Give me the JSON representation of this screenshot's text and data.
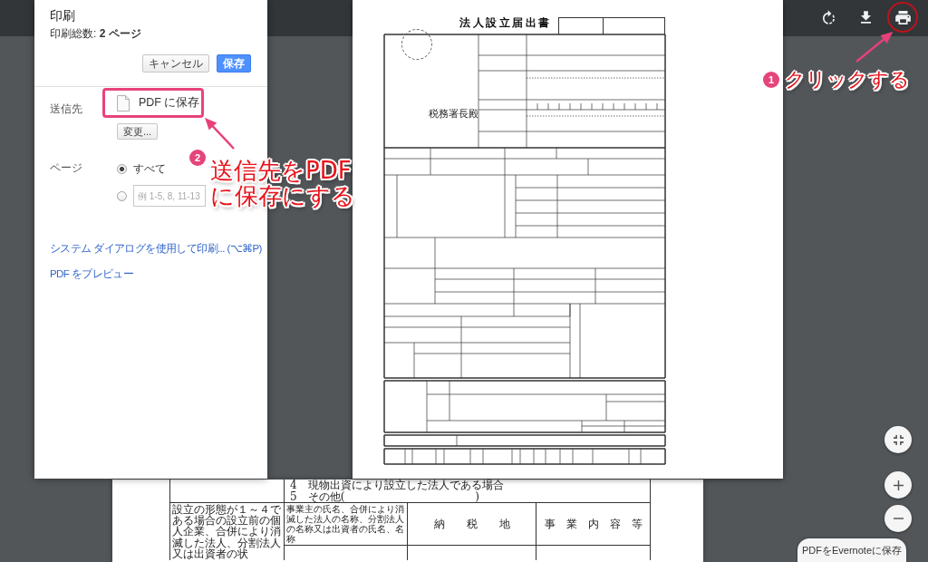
{
  "print_dialog": {
    "title": "印刷",
    "total": "印刷総数: **2 ページ**",
    "buttons": [
      {
        "label": "キャンセル",
        "kind": "secondary"
      },
      {
        "label": "保存",
        "kind": "primary"
      }
    ],
    "destination": {
      "label": "送信先",
      "value": "PDF に保存",
      "change_button": "変更..."
    },
    "pages": {
      "label": "ページ",
      "options": [
        {
          "kind": "all",
          "label": "すべて",
          "selected": true
        },
        {
          "kind": "range",
          "placeholder": "例 1-5, 8, 11-13",
          "selected": false
        }
      ]
    },
    "links": [
      "システム ダイアログを使用して印刷... (⌥⌘P)",
      "PDF をプレビュー"
    ]
  },
  "preview": {
    "form_title": "法人設立届出書",
    "addressee": "税務署長殿",
    "next_page": {
      "options": [
        "4　現物出資により設立した法人である場合",
        "5　その他(　　　　　　　　　　　　)"
      ],
      "row_label": "設立の形態が１～４である場合の設立前の個人企業、合併により消滅した法人、分割法人又は出資者の状",
      "columns": [
        "事業主の氏名、合併により消滅した法人の名称、分割法人の名称又は出資者の氏名、名称",
        "納　　税　　地",
        "事　業　内　容　等"
      ]
    }
  },
  "evernote_button": {
    "label": "PDFをEvernoteに保存"
  },
  "annotations": [
    {
      "kind": "ring",
      "number": "1",
      "lines": [
        "クリックする"
      ]
    },
    {
      "kind": "box",
      "number": "2",
      "lines": [
        "送信先をPDF",
        "に保存にする"
      ]
    }
  ]
}
